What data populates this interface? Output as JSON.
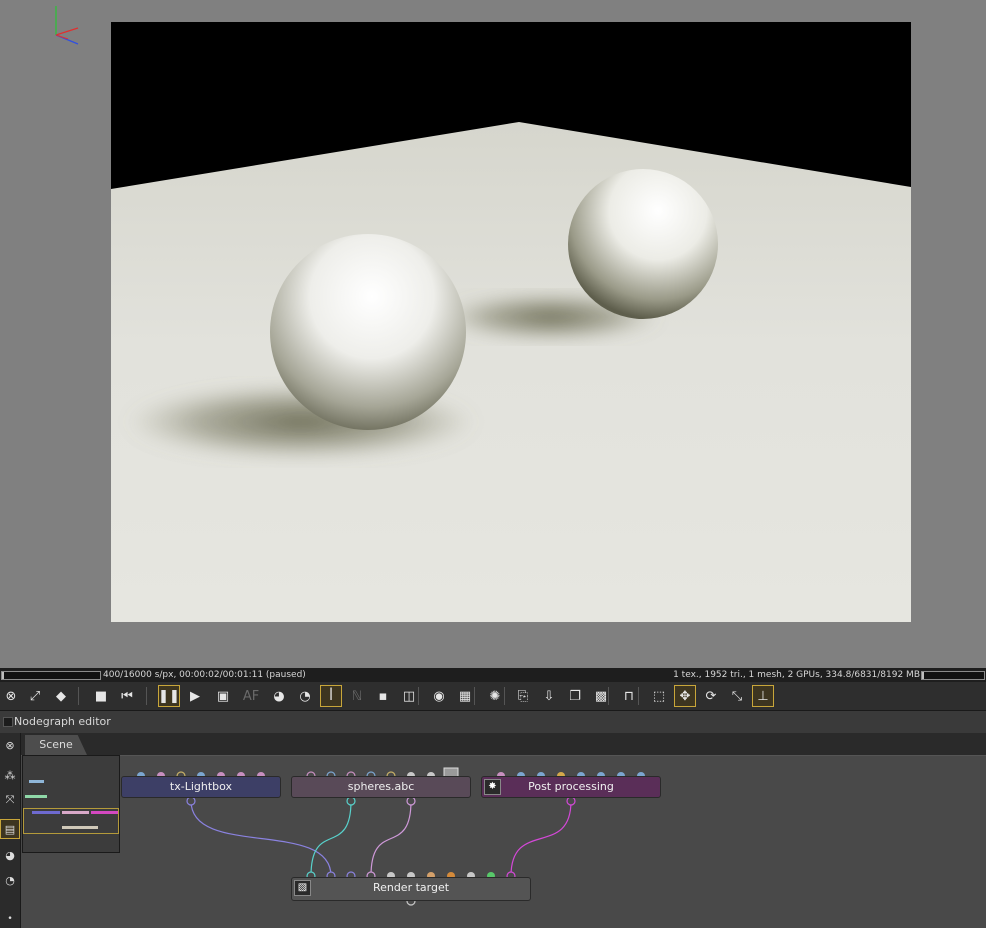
{
  "status_bar": {
    "progress_fraction": 0.025,
    "render_status": "400/16000 s/px, 00:00:02/00:01:11 (paused)",
    "scene_stats": "1 tex., 1952 tri., 1 mesh, 2 GPUs, 334.8/6831/8192 MB",
    "memory_fraction": 0.04
  },
  "toolbar": {
    "buttons": [
      {
        "name": "reset-camera-icon",
        "glyph": "⊗",
        "active": false
      },
      {
        "name": "fit-view-icon",
        "glyph": "⤢",
        "active": false
      },
      {
        "name": "cube-color-icon",
        "glyph": "◆",
        "active": false
      },
      {
        "name": "stop-render-icon",
        "glyph": "■",
        "active": false
      },
      {
        "name": "restart-render-icon",
        "glyph": "⏮",
        "active": false
      },
      {
        "name": "pause-render-icon",
        "glyph": "❚❚",
        "active": true
      },
      {
        "name": "start-render-icon",
        "glyph": "▶",
        "active": false
      },
      {
        "name": "display-icon",
        "glyph": "▣",
        "active": false
      },
      {
        "name": "af-icon",
        "glyph": "AF",
        "active": false,
        "dim": true
      },
      {
        "name": "color-picker-icon",
        "glyph": "◕",
        "active": false
      },
      {
        "name": "material-picker-icon",
        "glyph": "◔",
        "active": false
      },
      {
        "name": "object-picker-icon",
        "glyph": "ꟾ",
        "active": true
      },
      {
        "name": "nf-icon",
        "glyph": "ℕ",
        "active": false,
        "dim": true
      },
      {
        "name": "region-icon",
        "glyph": "▪",
        "active": false
      },
      {
        "name": "focus-icon",
        "glyph": "◫",
        "active": false
      },
      {
        "name": "camera-settings-icon",
        "glyph": "◉",
        "active": false
      },
      {
        "name": "background-icon",
        "glyph": "▦",
        "active": false
      },
      {
        "name": "progress-spinner-icon",
        "glyph": "✺",
        "active": false
      },
      {
        "name": "copy-icon",
        "glyph": "⎘",
        "active": false
      },
      {
        "name": "save-icon",
        "glyph": "⇩",
        "active": false
      },
      {
        "name": "layers-icon",
        "glyph": "❐",
        "active": false
      },
      {
        "name": "checker-icon",
        "glyph": "▩",
        "active": false
      },
      {
        "name": "lock-icon",
        "glyph": "⊓",
        "active": false
      },
      {
        "name": "box-icon",
        "glyph": "⬚",
        "active": false
      },
      {
        "name": "move-icon",
        "glyph": "✥",
        "active": true
      },
      {
        "name": "rotate-icon",
        "glyph": "⟳",
        "active": false
      },
      {
        "name": "expand-icon",
        "glyph": "⤡",
        "active": false
      },
      {
        "name": "axis-icon",
        "glyph": "⊥",
        "active": true
      }
    ]
  },
  "panel": {
    "title": "Nodegraph editor",
    "tabs": [
      {
        "label": "Scene"
      }
    ]
  },
  "side_toolbar": [
    {
      "name": "reset-graph-icon",
      "glyph": "⊗",
      "active": false
    },
    {
      "name": "arrange-nodes-icon",
      "glyph": "⁂",
      "active": false
    },
    {
      "name": "fit-nodes-icon",
      "glyph": "⤧",
      "active": false
    },
    {
      "name": "minimap-icon",
      "glyph": "▤",
      "active": true
    },
    {
      "name": "nodes-color-icon",
      "glyph": "◕",
      "active": false
    },
    {
      "name": "material-ball-icon",
      "glyph": "◔",
      "active": false
    },
    {
      "name": "small-dot-icon",
      "glyph": "•",
      "active": false
    }
  ],
  "nodes": {
    "lightbox": {
      "label": "tx-Lightbox",
      "color": "#3d3f66"
    },
    "spheres": {
      "label": "spheres.abc",
      "color": "#594a58"
    },
    "post": {
      "label": "Post processing",
      "color": "#5a2e58"
    },
    "render": {
      "label": "Render target",
      "color": "#545454"
    }
  },
  "wires": {
    "lightbox": "#8a82e0",
    "spheres_a": "#58d2cc",
    "spheres_b": "#cf99d9",
    "post": "#d448d8"
  }
}
